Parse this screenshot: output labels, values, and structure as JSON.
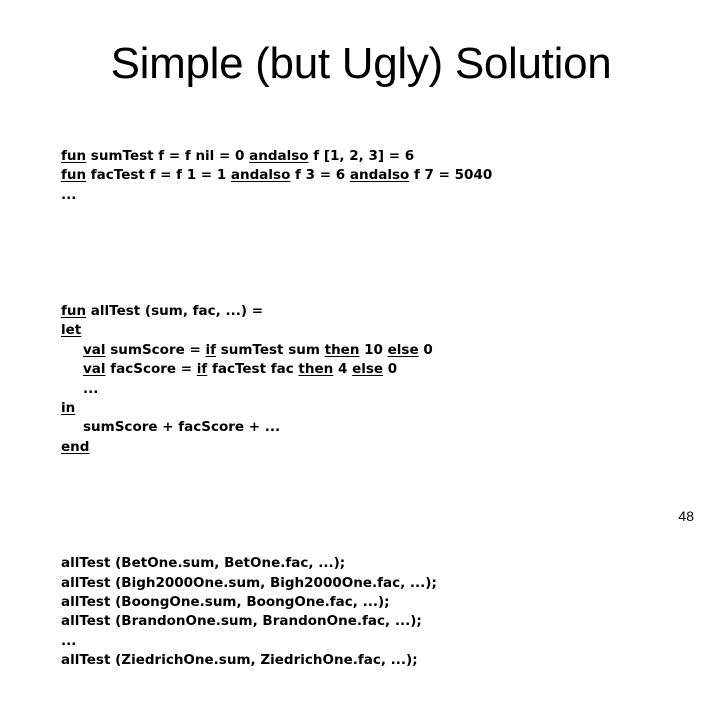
{
  "slide": {
    "title": "Simple (but Ugly) Solution",
    "page_number": "48",
    "code_block_1": [
      [
        {
          "t": "fun",
          "kw": true
        },
        {
          "t": " sumTest f = f nil = 0 "
        },
        {
          "t": "andalso",
          "kw": true
        },
        {
          "t": " f [1, 2, 3] = 6"
        }
      ],
      [
        {
          "t": "fun",
          "kw": true
        },
        {
          "t": " facTest f = f 1 = 1 "
        },
        {
          "t": "andalso",
          "kw": true
        },
        {
          "t": " f 3 = 6 "
        },
        {
          "t": "andalso",
          "kw": true
        },
        {
          "t": " f 7 = 5040"
        }
      ],
      [
        {
          "t": "..."
        }
      ]
    ],
    "code_block_2": [
      {
        "indent": false,
        "parts": [
          {
            "t": "fun",
            "kw": true
          },
          {
            "t": " allTest (sum, fac, ...) ="
          }
        ]
      },
      {
        "indent": false,
        "parts": [
          {
            "t": "let",
            "kw": true
          }
        ]
      },
      {
        "indent": true,
        "parts": [
          {
            "t": "val",
            "kw": true
          },
          {
            "t": " sumScore = "
          },
          {
            "t": "if",
            "kw": true
          },
          {
            "t": " sumTest sum "
          },
          {
            "t": "then",
            "kw": true
          },
          {
            "t": " 10 "
          },
          {
            "t": "else",
            "kw": true
          },
          {
            "t": " 0"
          }
        ]
      },
      {
        "indent": true,
        "parts": [
          {
            "t": "val",
            "kw": true
          },
          {
            "t": " facScore = "
          },
          {
            "t": "if",
            "kw": true
          },
          {
            "t": " facTest fac "
          },
          {
            "t": "then",
            "kw": true
          },
          {
            "t": " 4 "
          },
          {
            "t": "else",
            "kw": true
          },
          {
            "t": " 0"
          }
        ]
      },
      {
        "indent": true,
        "parts": [
          {
            "t": "..."
          }
        ]
      },
      {
        "indent": false,
        "parts": [
          {
            "t": "in",
            "kw": true
          }
        ]
      },
      {
        "indent": true,
        "parts": [
          {
            "t": "sumScore + facScore + ..."
          }
        ]
      },
      {
        "indent": false,
        "parts": [
          {
            "t": "end",
            "kw": true
          }
        ]
      }
    ],
    "code_block_3": [
      "allTest (BetOne.sum, BetOne.fac, ...);",
      "allTest (Bigh2000One.sum, Bigh2000One.fac, ...);",
      "allTest (BoongOne.sum, BoongOne.fac, ...);",
      "allTest (BrandonOne.sum, BrandonOne.fac, ...);",
      "...",
      "allTest (ZiedrichOne.sum, ZiedrichOne.fac, ...);"
    ]
  }
}
